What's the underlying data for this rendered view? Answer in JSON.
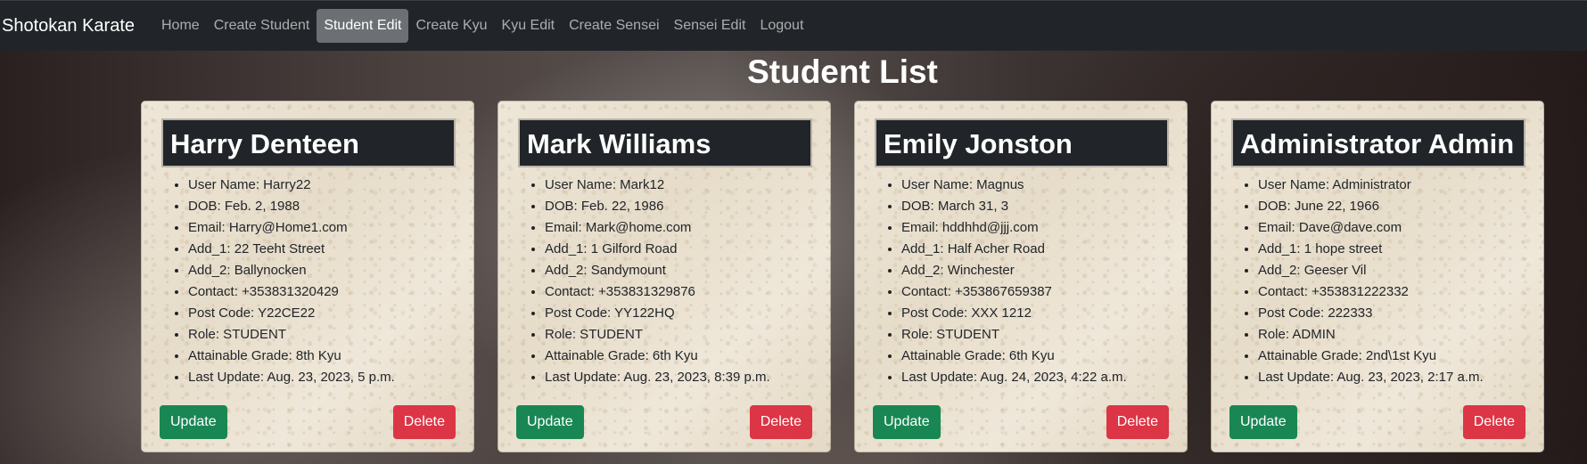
{
  "navbar": {
    "brand": "Shotokan Karate",
    "links": [
      {
        "label": "Home"
      },
      {
        "label": "Create Student"
      },
      {
        "label": "Student Edit"
      },
      {
        "label": "Create Kyu"
      },
      {
        "label": "Kyu Edit"
      },
      {
        "label": "Create Sensei"
      },
      {
        "label": "Sensei Edit"
      },
      {
        "label": "Logout"
      }
    ],
    "active": "Student Edit"
  },
  "page": {
    "title": "Student List"
  },
  "cards": [
    {
      "name": "Harry Denteen",
      "fields": [
        "User Name: Harry22",
        "DOB: Feb. 2, 1988",
        "Email: Harry@Home1.com",
        "Add_1: 22 Teeht Street",
        "Add_2: Ballynocken",
        "Contact: +353831320429",
        "Post Code: Y22CE22",
        "Role: STUDENT",
        "Attainable Grade: 8th Kyu",
        "Last Update: Aug. 23, 2023, 5 p.m."
      ],
      "update_label": "Update",
      "delete_label": "Delete"
    },
    {
      "name": "Mark Williams",
      "fields": [
        "User Name: Mark12",
        "DOB: Feb. 22, 1986",
        "Email: Mark@home.com",
        "Add_1: 1 Gilford Road",
        "Add_2: Sandymount",
        "Contact: +353831329876",
        "Post Code: YY122HQ",
        "Role: STUDENT",
        "Attainable Grade: 6th Kyu",
        "Last Update: Aug. 23, 2023, 8:39 p.m."
      ],
      "update_label": "Update",
      "delete_label": "Delete"
    },
    {
      "name": "Emily Jonston",
      "fields": [
        "User Name: Magnus",
        "DOB: March 31, 3",
        "Email: hddhhd@jjj.com",
        "Add_1: Half Acher Road",
        "Add_2: Winchester",
        "Contact: +353867659387",
        "Post Code: XXX 1212",
        "Role: STUDENT",
        "Attainable Grade: 6th Kyu",
        "Last Update: Aug. 24, 2023, 4:22 a.m."
      ],
      "update_label": "Update",
      "delete_label": "Delete"
    },
    {
      "name": "Administrator Admin",
      "fields": [
        "User Name: Administrator",
        "DOB: June 22, 1966",
        "Email: Dave@dave.com",
        "Add_1: 1 hope street",
        "Add_2: Geeser Vil",
        "Contact: +353831222332",
        "Post Code: 222333",
        "Role: ADMIN",
        "Attainable Grade: 2nd\\1st Kyu",
        "Last Update: Aug. 23, 2023, 2:17 a.m."
      ],
      "update_label": "Update",
      "delete_label": "Delete"
    }
  ],
  "colors": {
    "navbar_bg": "#212529",
    "active_link_bg": "#6c6f73",
    "update_button": "#198754",
    "delete_button": "#dc3545",
    "card_header_bg": "#212529"
  }
}
